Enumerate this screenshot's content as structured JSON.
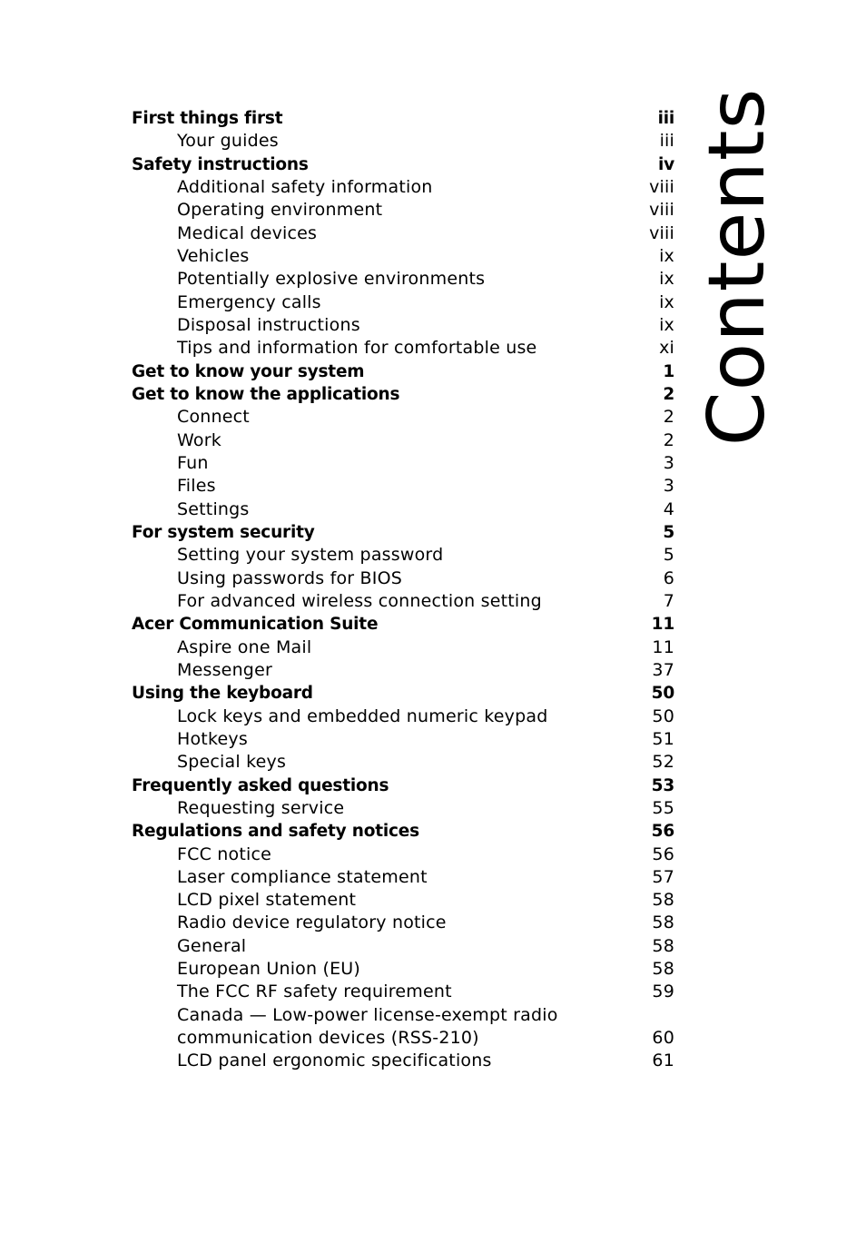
{
  "page": {
    "title": "Contents"
  },
  "toc": [
    {
      "title": "First things first",
      "page": "iii",
      "level": 1
    },
    {
      "title": "Your guides",
      "page": "iii",
      "level": 2
    },
    {
      "title": "Safety instructions",
      "page": "iv",
      "level": 1
    },
    {
      "title": "Additional safety information",
      "page": "viii",
      "level": 2
    },
    {
      "title": "Operating environment",
      "page": "viii",
      "level": 2
    },
    {
      "title": "Medical devices",
      "page": "viii",
      "level": 2
    },
    {
      "title": "Vehicles",
      "page": "ix",
      "level": 2
    },
    {
      "title": "Potentially explosive environments",
      "page": "ix",
      "level": 2
    },
    {
      "title": "Emergency calls",
      "page": "ix",
      "level": 2
    },
    {
      "title": "Disposal instructions",
      "page": "ix",
      "level": 2
    },
    {
      "title": "Tips and information for comfortable use",
      "page": "xi",
      "level": 2
    },
    {
      "title": "Get to know your system",
      "page": "1",
      "level": 1
    },
    {
      "title": "Get to know the applications",
      "page": "2",
      "level": 1
    },
    {
      "title": "Connect",
      "page": "2",
      "level": 2
    },
    {
      "title": "Work",
      "page": "2",
      "level": 2
    },
    {
      "title": "Fun",
      "page": "3",
      "level": 2
    },
    {
      "title": "Files",
      "page": "3",
      "level": 2
    },
    {
      "title": "Settings",
      "page": "4",
      "level": 2
    },
    {
      "title": "For system security",
      "page": "5",
      "level": 1
    },
    {
      "title": "Setting your system password",
      "page": "5",
      "level": 2
    },
    {
      "title": "Using passwords for BIOS",
      "page": "6",
      "level": 2
    },
    {
      "title": "For advanced wireless connection setting",
      "page": "7",
      "level": 2
    },
    {
      "title": "Acer Communication Suite",
      "page": "11",
      "level": 1
    },
    {
      "title": "Aspire one Mail",
      "page": "11",
      "level": 2
    },
    {
      "title": "Messenger",
      "page": "37",
      "level": 2
    },
    {
      "title": "Using the keyboard",
      "page": "50",
      "level": 1
    },
    {
      "title": "Lock keys and embedded numeric keypad",
      "page": "50",
      "level": 2
    },
    {
      "title": "Hotkeys",
      "page": "51",
      "level": 2
    },
    {
      "title": "Special keys",
      "page": "52",
      "level": 2
    },
    {
      "title": "Frequently asked questions",
      "page": "53",
      "level": 1
    },
    {
      "title": "Requesting service",
      "page": "55",
      "level": 2
    },
    {
      "title": "Regulations and safety notices",
      "page": "56",
      "level": 1
    },
    {
      "title": "FCC notice",
      "page": "56",
      "level": 2
    },
    {
      "title": "Laser compliance statement",
      "page": "57",
      "level": 2
    },
    {
      "title": "LCD pixel statement",
      "page": "58",
      "level": 2
    },
    {
      "title": "Radio device regulatory notice",
      "page": "58",
      "level": 2
    },
    {
      "title": "General",
      "page": "58",
      "level": 2
    },
    {
      "title": "European Union (EU)",
      "page": "58",
      "level": 2
    },
    {
      "title": "The FCC RF safety requirement",
      "page": "59",
      "level": 2
    },
    {
      "title": "Canada — Low-power license-exempt radio",
      "page": "",
      "level": 2
    },
    {
      "title": "communication devices (RSS-210)",
      "page": "60",
      "level": 2
    },
    {
      "title": "LCD panel ergonomic specifications",
      "page": "61",
      "level": 2
    }
  ]
}
